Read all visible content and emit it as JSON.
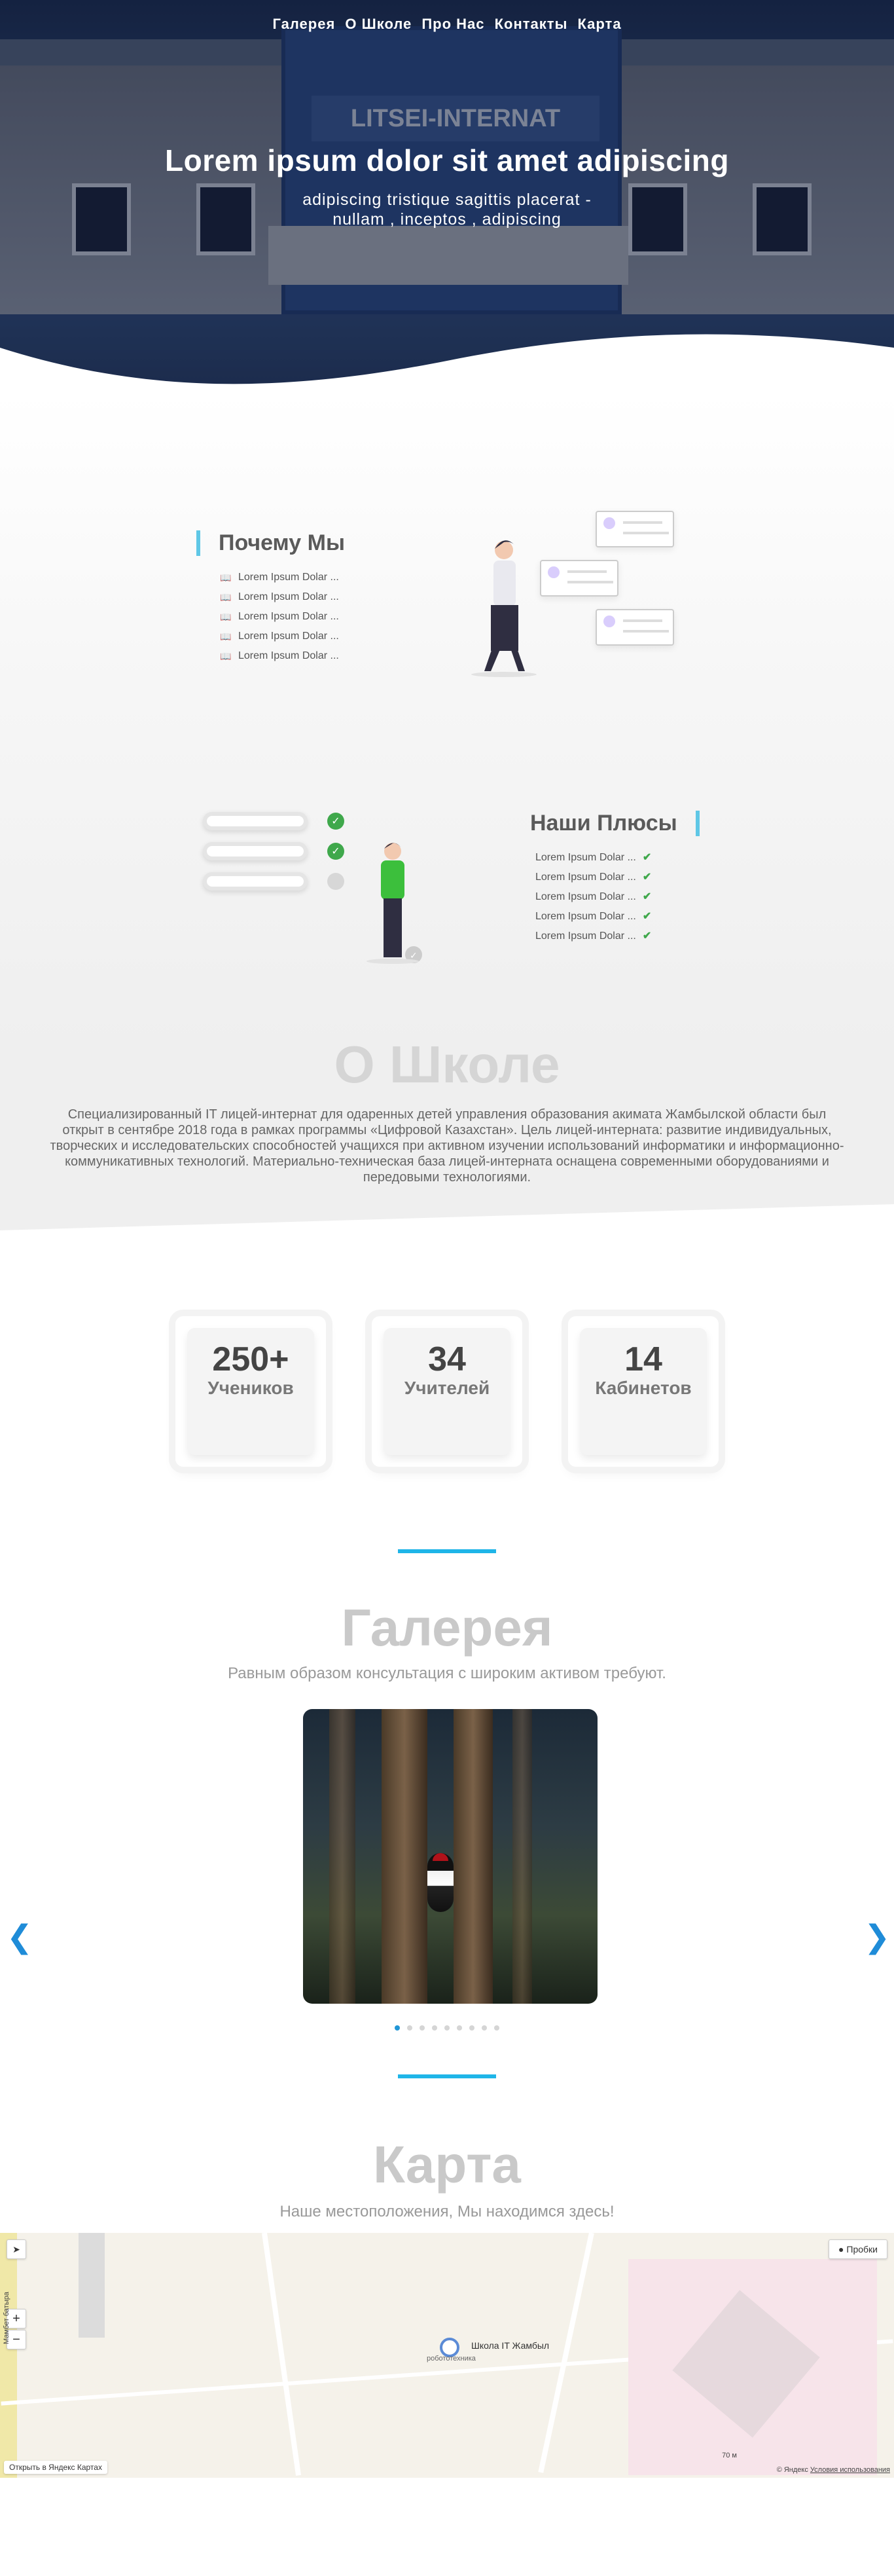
{
  "nav": {
    "items": [
      "Галерея",
      "О Школе",
      "Про Нас",
      "Контакты",
      "Карта"
    ]
  },
  "hero": {
    "title": "Lorem ipsum dolor sit amet adipiscing",
    "subtitle_line1": "adipiscing tristique sagittis placerat -",
    "subtitle_line2": "nullam , inceptos , adipiscing",
    "sign_text": "LITSEI-INTERNAT"
  },
  "why": {
    "title": "Почему Мы",
    "items": [
      "Lorem Ipsum Dolar ...",
      "Lorem Ipsum Dolar ...",
      "Lorem Ipsum Dolar ...",
      "Lorem Ipsum Dolar ...",
      "Lorem Ipsum Dolar ..."
    ],
    "item_icon": "book-icon"
  },
  "plus": {
    "title": "Наши Плюсы",
    "items": [
      "Lorem Ipsum Dolar ...",
      "Lorem Ipsum Dolar ...",
      "Lorem Ipsum Dolar ...",
      "Lorem Ipsum Dolar ...",
      "Lorem Ipsum Dolar ..."
    ],
    "item_icon": "check-icon"
  },
  "about": {
    "title": "О Школе",
    "text": "Специализированный IT лицей-интернат для одаренных детей управления образования акимата Жамбылской области был открыт в сентябре 2018 года в рамках программы «Цифровой Казахстан». Цель лицей-интерната: развитие индивидуальных, творческих и исследовательских способностей учащихся при активном изучении использований информатики и информационно-коммуникативных технологий. Материально-техническая база лицей-интерната оснащена современными оборудованиями и передовыми технологиями."
  },
  "stats": [
    {
      "num": "250+",
      "label": "Учеников"
    },
    {
      "num": "34",
      "label": "Учителей"
    },
    {
      "num": "14",
      "label": "Кабинетов"
    }
  ],
  "gallery": {
    "title": "Галерея",
    "subtitle": "Равным образом консультация с широким активом требуют.",
    "slide_count": 9,
    "active_slide": 1
  },
  "map": {
    "title": "Карта",
    "subtitle": "Наше местоположения, Мы находимся здесь!",
    "place_label": "Школа IT Жамбыл",
    "place_sub": "робототехника",
    "street": "Мамбет батыра",
    "traffic_button": "Пробки",
    "zoom_in": "+",
    "zoom_out": "−",
    "open_link": "Открыть в Яндекс Картах",
    "copyright": "© Яндекс",
    "terms": "Условия использования",
    "scale": "70 м"
  },
  "colors": {
    "accent": "#1fb5e8",
    "check": "#3fa84b",
    "heading_faded": "#c9c9c9"
  }
}
